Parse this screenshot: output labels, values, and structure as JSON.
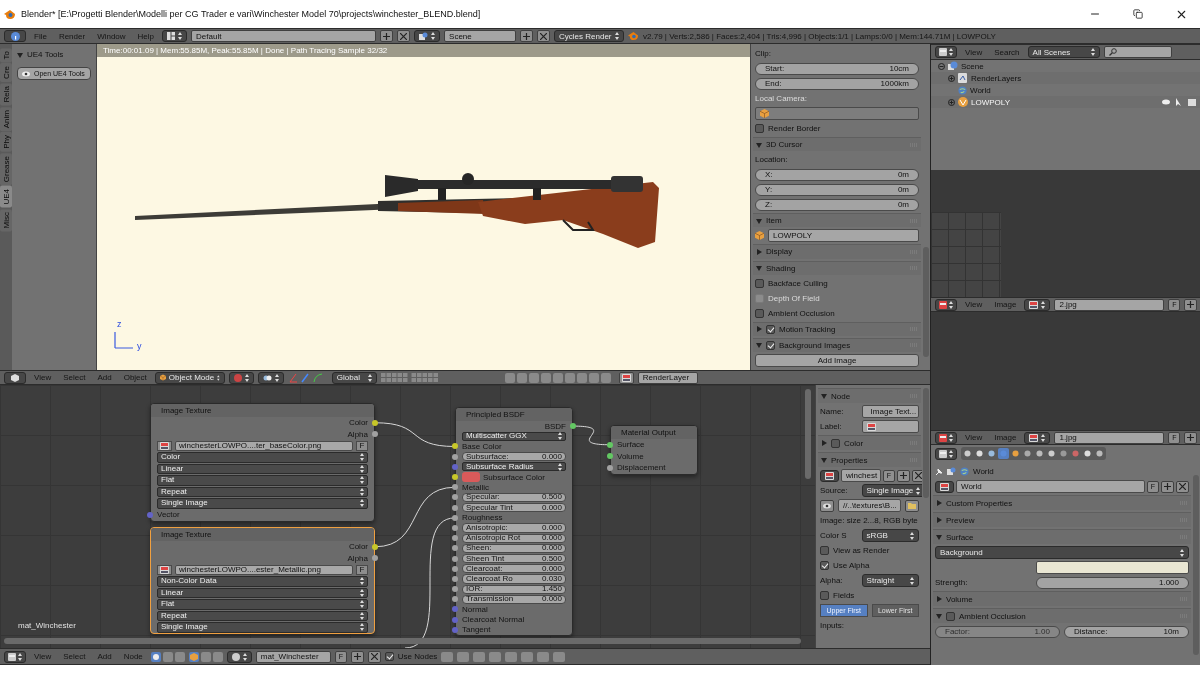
{
  "title_bar": {
    "title": "Blender* [E:\\Progetti Blender\\Modelli per CG Trader e vari\\Winchester Model 70\\projects\\winchester_BLEND.blend]"
  },
  "info_header": {
    "menus": [
      "File",
      "Render",
      "Window",
      "Help"
    ],
    "layout": "Default",
    "scene": "Scene",
    "engine": "Cycles Render",
    "stats": "v2.79 | Verts:2,586 | Faces:2,404 | Tris:4,996 | Objects:1/1 | Lamps:0/0 | Mem:144.71M | LOWPOLY"
  },
  "tool_shelf": {
    "tabs": [
      {
        "label": "To",
        "selected": false
      },
      {
        "label": "Cre",
        "selected": false
      },
      {
        "label": "Rela",
        "selected": false
      },
      {
        "label": "Anim",
        "selected": false
      },
      {
        "label": "Phy",
        "selected": false
      },
      {
        "label": "Grease",
        "selected": false
      },
      {
        "label": "UE4",
        "selected": true
      },
      {
        "label": "Misc",
        "selected": false
      }
    ],
    "panel_title": "UE4 Tools",
    "button": "Open UE4 Tools"
  },
  "viewport": {
    "status": "Time:00:01.09 | Mem:55.85M, Peak:55.85M | Done | Path Tracing Sample 32/32",
    "axes": [
      "z",
      "y"
    ]
  },
  "view_properties": [
    {
      "kind": "label",
      "text": "Clip:",
      "disabled": false
    },
    {
      "kind": "number",
      "label": "Start:",
      "value": "10cm"
    },
    {
      "kind": "number",
      "label": "End:",
      "value": "1000km"
    },
    {
      "kind": "label",
      "text": "Local Camera:",
      "disabled": true
    },
    {
      "kind": "picker"
    },
    {
      "kind": "check",
      "label": "Render Border",
      "checked": false,
      "disabled": false
    },
    {
      "kind": "panel",
      "title": "3D Cursor",
      "expanded": true
    },
    {
      "kind": "label",
      "text": "Location:",
      "disabled": false
    },
    {
      "kind": "number",
      "label": "X:",
      "value": "0m"
    },
    {
      "kind": "number",
      "label": "Y:",
      "value": "0m"
    },
    {
      "kind": "number",
      "label": "Z:",
      "value": "0m"
    },
    {
      "kind": "panel",
      "title": "Item",
      "expanded": true
    },
    {
      "kind": "object",
      "value": "LOWPOLY"
    },
    {
      "kind": "panel",
      "title": "Display",
      "expanded": false
    },
    {
      "kind": "panel",
      "title": "Shading",
      "expanded": true
    },
    {
      "kind": "check",
      "label": "Backface Culling",
      "checked": false,
      "disabled": false
    },
    {
      "kind": "check",
      "label": "Depth Of Field",
      "checked": false,
      "disabled": true
    },
    {
      "kind": "check",
      "label": "Ambient Occlusion",
      "checked": false,
      "disabled": false
    },
    {
      "kind": "panel_check",
      "title": "Motion Tracking",
      "expanded": false,
      "checked": true
    },
    {
      "kind": "panel_check",
      "title": "Background Images",
      "expanded": true,
      "checked": true
    },
    {
      "kind": "button",
      "label": "Add Image"
    }
  ],
  "view3d_header": {
    "menus": [
      "View",
      "Select",
      "Add",
      "Object"
    ],
    "mode": "Object Mode",
    "orientation": "Global",
    "render_layer": "RenderLayer"
  },
  "node_editor": {
    "material_label": "mat_Winchester",
    "nodes": [
      {
        "title": "Image Texture",
        "selected": false,
        "rows": [
          {
            "kind": "out",
            "label": "Color",
            "color": "#c7c729"
          },
          {
            "kind": "out",
            "label": "Alpha",
            "color": "#a1a1a1"
          },
          {
            "kind": "file",
            "value": "winchesterLOWPO....ter_baseColor.png",
            "fake": "F"
          },
          {
            "kind": "dropdown",
            "value": "Color"
          },
          {
            "kind": "dropdown",
            "value": "Linear"
          },
          {
            "kind": "dropdown",
            "value": "Flat"
          },
          {
            "kind": "dropdown",
            "value": "Repeat"
          },
          {
            "kind": "dropdown",
            "value": "Single Image"
          },
          {
            "kind": "in",
            "label": "Vector",
            "color": "#6363c7"
          }
        ]
      },
      {
        "title": "Image Texture",
        "selected": true,
        "rows": [
          {
            "kind": "out",
            "label": "Color",
            "color": "#c7c729"
          },
          {
            "kind": "out",
            "label": "Alpha",
            "color": "#a1a1a1"
          },
          {
            "kind": "file",
            "value": "winchesterLOWPO....ester_Metallic.png",
            "fake": "F"
          },
          {
            "kind": "dropdown",
            "value": "Non-Color Data"
          },
          {
            "kind": "dropdown",
            "value": "Linear"
          },
          {
            "kind": "dropdown",
            "value": "Flat"
          },
          {
            "kind": "dropdown",
            "value": "Repeat"
          },
          {
            "kind": "dropdown",
            "value": "Single Image"
          }
        ]
      },
      {
        "title": "Principled BSDF",
        "selected": false,
        "rows": [
          {
            "kind": "out",
            "label": "BSDF",
            "color": "#63c763"
          },
          {
            "kind": "dropdown",
            "value": "Multiscatter GGX"
          },
          {
            "kind": "in",
            "label": "Base Color",
            "color": "#c7c729"
          },
          {
            "kind": "slider",
            "label": "Subsurface:",
            "value": "0.000",
            "color": "#a1a1a1"
          },
          {
            "kind": "dropdown",
            "value": "Subsurface Radius",
            "color": "#6363c7"
          },
          {
            "kind": "swatch",
            "label": "Subsurface Color",
            "color": "#c7c729",
            "swatch": {
              "color": "#d95a5a"
            }
          },
          {
            "kind": "in",
            "label": "Metallic",
            "color": "#a1a1a1"
          },
          {
            "kind": "slider",
            "label": "Specular:",
            "value": "0.500",
            "color": "#a1a1a1"
          },
          {
            "kind": "slider",
            "label": "Specular Tint",
            "value": "0.000",
            "color": "#a1a1a1"
          },
          {
            "kind": "in",
            "label": "Roughness",
            "color": "#a1a1a1"
          },
          {
            "kind": "slider",
            "label": "Anisotropic:",
            "value": "0.000",
            "color": "#a1a1a1"
          },
          {
            "kind": "slider",
            "label": "Anisotropic Rot",
            "value": "0.000",
            "color": "#a1a1a1"
          },
          {
            "kind": "slider",
            "label": "Sheen:",
            "value": "0.000",
            "color": "#a1a1a1"
          },
          {
            "kind": "slider",
            "label": "Sheen Tint",
            "value": "0.500",
            "color": "#a1a1a1"
          },
          {
            "kind": "slider",
            "label": "Clearcoat:",
            "value": "0.000",
            "color": "#a1a1a1"
          },
          {
            "kind": "slider",
            "label": "Clearcoat Ro",
            "value": "0.030",
            "color": "#a1a1a1"
          },
          {
            "kind": "slider",
            "label": "IOR:",
            "value": "1.450",
            "color": "#a1a1a1"
          },
          {
            "kind": "slider",
            "label": "Transmission",
            "value": "0.000",
            "color": "#a1a1a1"
          },
          {
            "kind": "in",
            "label": "Normal",
            "color": "#6363c7"
          },
          {
            "kind": "in",
            "label": "Clearcoat Normal",
            "color": "#6363c7"
          },
          {
            "kind": "in",
            "label": "Tangent",
            "color": "#6363c7"
          }
        ]
      },
      {
        "title": "Material Output",
        "selected": false,
        "rows": [
          {
            "kind": "in",
            "label": "Surface",
            "color": "#63c763"
          },
          {
            "kind": "in",
            "label": "Volume",
            "color": "#63c763"
          },
          {
            "kind": "in",
            "label": "Displacement",
            "color": "#a1a1a1"
          }
        ]
      }
    ]
  },
  "node_sidebar": [
    {
      "kind": "panel",
      "title": "Node",
      "expanded": true
    },
    {
      "kind": "name_field",
      "label": "Name:",
      "value": "Image Text..."
    },
    {
      "kind": "name_field",
      "label": "Label:"
    },
    {
      "kind": "panel_check",
      "title": "Color",
      "expanded": false,
      "checked": false
    },
    {
      "kind": "panel",
      "title": "Properties",
      "expanded": true
    },
    {
      "kind": "datablock",
      "value": "winchest",
      "fake": "F"
    },
    {
      "kind": "select",
      "label": "Source:",
      "value": "Single Image"
    },
    {
      "kind": "path",
      "value": "//..\\textures\\B..."
    },
    {
      "kind": "label",
      "text": "Image: size 2...8, RGB byte",
      "disabled": false
    },
    {
      "kind": "select",
      "label": "Color S",
      "value": "sRGB"
    },
    {
      "kind": "check",
      "label": "View as Render",
      "checked": false,
      "disabled": false
    },
    {
      "kind": "check",
      "label": "Use Alpha",
      "checked": true,
      "disabled": false
    },
    {
      "kind": "select",
      "label": "Alpha:",
      "value": "Straight"
    },
    {
      "kind": "check",
      "label": "Fields",
      "checked": false,
      "disabled": false
    },
    {
      "kind": "toggle",
      "options": [
        {
          "label": "Upper First",
          "selected": true
        },
        {
          "label": "Lower First",
          "selected": false
        }
      ]
    },
    {
      "kind": "label",
      "text": "Inputs:",
      "disabled": false
    }
  ],
  "node_header": {
    "menus": [
      "View",
      "Select",
      "Add",
      "Node"
    ],
    "material": "mat_Winchester",
    "fake": "F",
    "use_nodes": {
      "label": "Use Nodes",
      "checked": true
    }
  },
  "outliner": {
    "menus": [
      "View",
      "Search"
    ],
    "scenes": "All Scenes",
    "tree": [
      {
        "label": "Scene",
        "kind": "scene",
        "expanded": true,
        "selected": false,
        "children": [
          {
            "label": "RenderLayers",
            "kind": "render_layers",
            "expanded": false,
            "selected": false
          },
          {
            "label": "World",
            "kind": "world",
            "selected": false
          },
          {
            "label": "LOWPOLY",
            "kind": "object",
            "expanded": false,
            "selected": true
          }
        ]
      }
    ]
  },
  "image_editors": [
    {
      "menus": [
        "View",
        "Image"
      ],
      "image": "2.jpg",
      "fake": "F"
    },
    {
      "menus": [
        "View",
        "Image"
      ],
      "image": "1.jpg",
      "fake": "F"
    }
  ],
  "properties": {
    "tabs": [
      {
        "selected": false
      },
      {
        "selected": false
      },
      {
        "selected": false
      },
      {
        "selected": true
      },
      {
        "selected": false
      },
      {
        "selected": false
      },
      {
        "selected": false
      },
      {
        "selected": false
      },
      {
        "selected": false
      },
      {
        "selected": false
      },
      {
        "selected": false
      },
      {
        "selected": false
      }
    ],
    "rows": [
      {
        "kind": "breadcrumb",
        "text": "World"
      },
      {
        "kind": "datablock",
        "value": "World",
        "fake": "F"
      },
      {
        "kind": "panel",
        "title": "Custom Properties",
        "expanded": false
      },
      {
        "kind": "panel",
        "title": "Preview",
        "expanded": false
      },
      {
        "kind": "panel",
        "title": "Surface",
        "expanded": true
      },
      {
        "kind": "select",
        "value": "Background"
      },
      {
        "kind": "color",
        "color": "#e9e6d3"
      },
      {
        "kind": "slider",
        "label": "Strength:",
        "value": "1.000"
      },
      {
        "kind": "panel",
        "title": "Volume",
        "expanded": false
      },
      {
        "kind": "panel_check",
        "title": "Ambient Occlusion",
        "expanded": true,
        "checked": false
      },
      {
        "kind": "pair",
        "items": [
          {
            "label": "Factor:",
            "value": "1.00",
            "disabled": true
          },
          {
            "label": "Distance:",
            "value": "10m",
            "disabled": false
          }
        ]
      }
    ]
  }
}
